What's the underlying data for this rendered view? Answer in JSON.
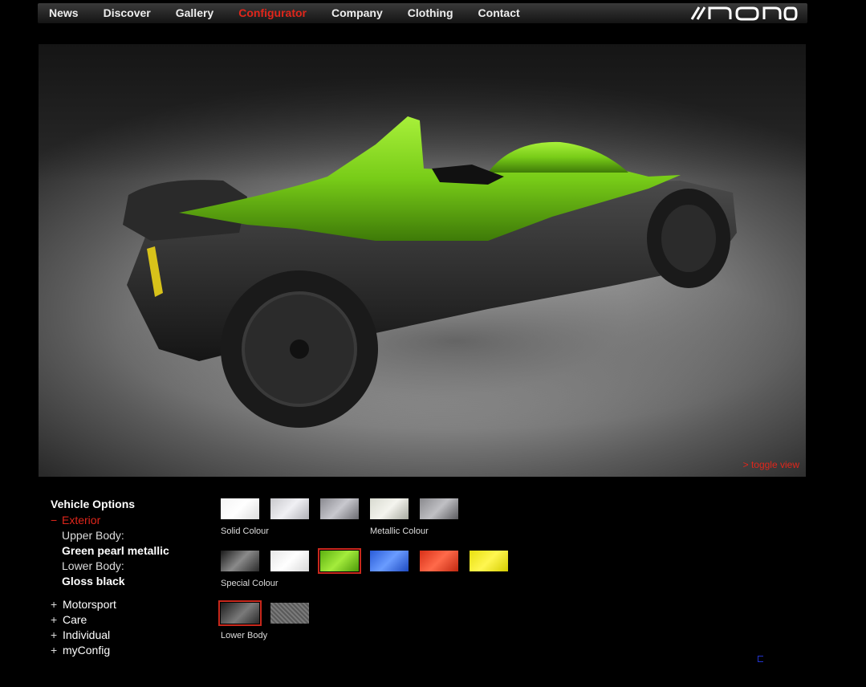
{
  "nav": {
    "items": [
      {
        "label": "News",
        "active": false
      },
      {
        "label": "Discover",
        "active": false
      },
      {
        "label": "Gallery",
        "active": false
      },
      {
        "label": "Configurator",
        "active": true
      },
      {
        "label": "Company",
        "active": false
      },
      {
        "label": "Clothing",
        "active": false
      },
      {
        "label": "Contact",
        "active": false
      }
    ],
    "logo_icon": "mono-logo-icon"
  },
  "viewer": {
    "toggle_label": "> toggle view"
  },
  "options": {
    "title": "Vehicle Options",
    "exterior_symbol": "−",
    "exterior_label": "Exterior",
    "upper_body_label": "Upper Body:",
    "upper_body_value": "Green pearl metallic",
    "lower_body_label": "Lower Body:",
    "lower_body_value": "Gloss black",
    "more_symbol": "+",
    "sections": [
      "Motorsport",
      "Care",
      "Individual",
      "myConfig"
    ]
  },
  "swatch_groups": {
    "solid_label": "Solid Colour",
    "metallic_label": "Metallic Colour",
    "special_label": "Special Colour",
    "lower_label": "Lower Body"
  },
  "colors": {
    "accent": "#e0261b",
    "selected_border": "#c8281c",
    "car_green": "#7cd21e"
  }
}
